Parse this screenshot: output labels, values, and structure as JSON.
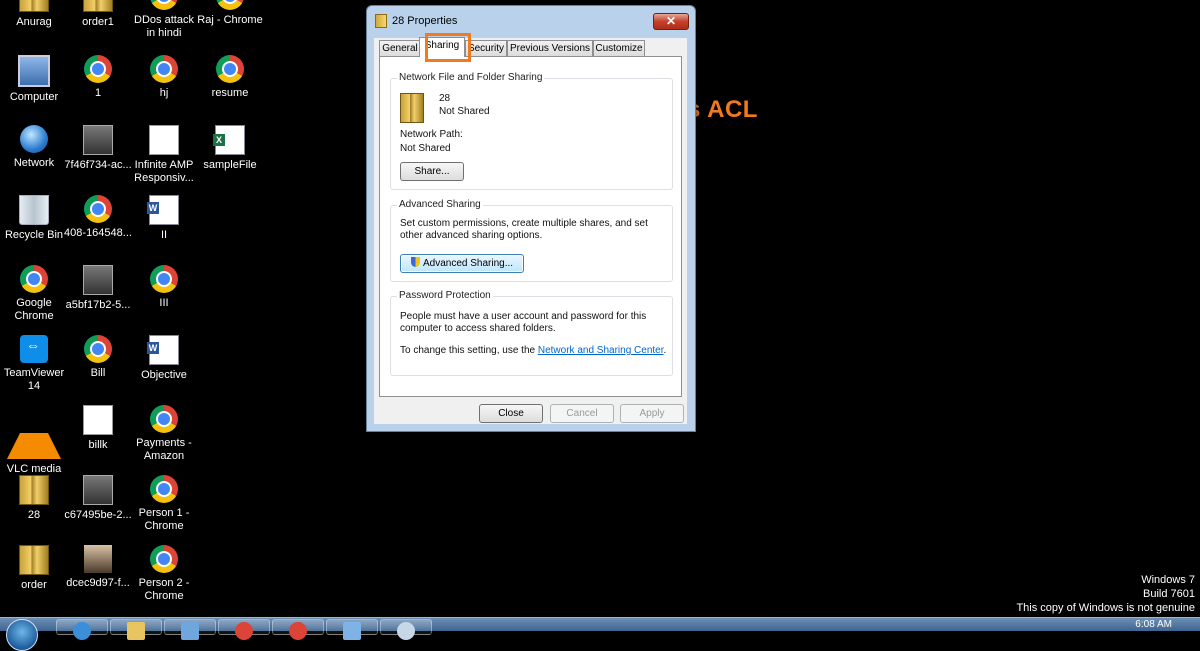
{
  "desktop_icons": [
    {
      "label": "Anurag",
      "icon": "folder-icon"
    },
    {
      "label": "order1",
      "icon": "folder-icon"
    },
    {
      "label": "DDos attack in hindi",
      "icon": "chrome-icon"
    },
    {
      "label": "Raj - Chrome",
      "icon": "chrome-icon"
    },
    {
      "label": "Computer",
      "icon": "computer-icon"
    },
    {
      "label": "1",
      "icon": "chrome-icon"
    },
    {
      "label": "hj",
      "icon": "chrome-icon"
    },
    {
      "label": "resume",
      "icon": "chrome-icon"
    },
    {
      "label": "Network",
      "icon": "network-icon"
    },
    {
      "label": "7f46f734-ac...",
      "icon": "photo-icon"
    },
    {
      "label": "Infinite AMP Responsiv...",
      "icon": "document-icon"
    },
    {
      "label": "sampleFile",
      "icon": "excel-icon"
    },
    {
      "label": "Recycle Bin",
      "icon": "recycle-bin-icon"
    },
    {
      "label": "408-164548...",
      "icon": "chrome-icon"
    },
    {
      "label": "II",
      "icon": "word-icon"
    },
    {
      "label": "Google Chrome",
      "icon": "chrome-icon"
    },
    {
      "label": "a5bf17b2-5...",
      "icon": "photo-icon"
    },
    {
      "label": "III",
      "icon": "chrome-icon"
    },
    {
      "label": "TeamViewer 14",
      "icon": "teamviewer-icon"
    },
    {
      "label": "Bill",
      "icon": "chrome-icon"
    },
    {
      "label": "Objective",
      "icon": "word-icon"
    },
    {
      "label": "VLC media player",
      "icon": "vlc-icon"
    },
    {
      "label": "billk",
      "icon": "document-icon"
    },
    {
      "label": "Payments - Amazon",
      "icon": "chrome-icon"
    },
    {
      "label": "28",
      "icon": "folder-icon"
    },
    {
      "label": "c67495be-2...",
      "icon": "photo-icon"
    },
    {
      "label": "Person 1 - Chrome",
      "icon": "chrome-icon"
    },
    {
      "label": "order",
      "icon": "folder-icon"
    },
    {
      "label": "dcec9d97-f...",
      "icon": "person-photo-icon"
    },
    {
      "label": "Person 2 - Chrome",
      "icon": "chrome-icon"
    }
  ],
  "dialog": {
    "title": "28 Properties",
    "close_label": "✕",
    "tabs": [
      "General",
      "Sharing",
      "Security",
      "Previous Versions",
      "Customize"
    ],
    "active_tab": "Sharing",
    "network_sharing": {
      "group_title": "Network File and Folder Sharing",
      "folder_name": "28",
      "share_status": "Not Shared",
      "network_path_label": "Network Path:",
      "network_path_value": "Not Shared",
      "share_button": "Share..."
    },
    "advanced_sharing": {
      "group_title": "Advanced Sharing",
      "description": "Set custom permissions, create multiple shares, and set other advanced sharing options.",
      "button": "Advanced Sharing..."
    },
    "password_protection": {
      "group_title": "Password Protection",
      "description": "People must have a user account and password for this computer to access shared folders.",
      "change_prefix": "To change this setting, use the ",
      "link_text": "Network and Sharing Center",
      "change_suffix": "."
    },
    "buttons": {
      "close": "Close",
      "cancel": "Cancel",
      "apply": "Apply"
    }
  },
  "annotation": {
    "text": "windows ACL",
    "color": "#f07a1c"
  },
  "genuine_notice": {
    "line1": "Windows 7",
    "line2": "Build 7601",
    "line3": "This copy of Windows is not genuine"
  },
  "taskbar": {
    "clock": "6:08 AM"
  }
}
